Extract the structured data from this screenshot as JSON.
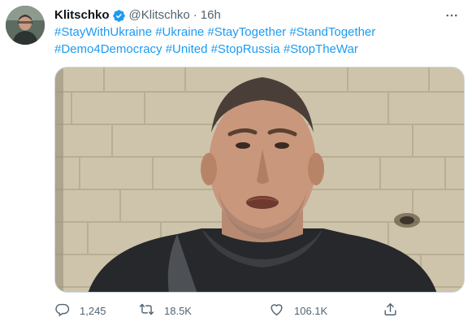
{
  "author": {
    "name": "Klitschko",
    "handle": "@Klitschko",
    "separator": "·",
    "time": "16h",
    "verified": true
  },
  "tweet": {
    "line1": [
      "#StayWithUkraine",
      "#Ukraine",
      "#StayTogether",
      "#StandTogether"
    ],
    "line2": [
      "#Demo4Democracy",
      "#United",
      "#StopRussia",
      "#StopTheWar"
    ]
  },
  "actions": {
    "reply_count": "1,245",
    "retweet_count": "18.5K",
    "like_count": "106.1K"
  },
  "icons": {
    "verified": "verified-badge-icon",
    "more": "more-options-icon",
    "reply": "reply-icon",
    "retweet": "retweet-icon",
    "like": "heart-icon",
    "share": "share-icon",
    "media": "video-thumbnail"
  },
  "colors": {
    "accent": "#1d9bf0",
    "secondary_text": "#536471",
    "primary_text": "#0f1419"
  }
}
